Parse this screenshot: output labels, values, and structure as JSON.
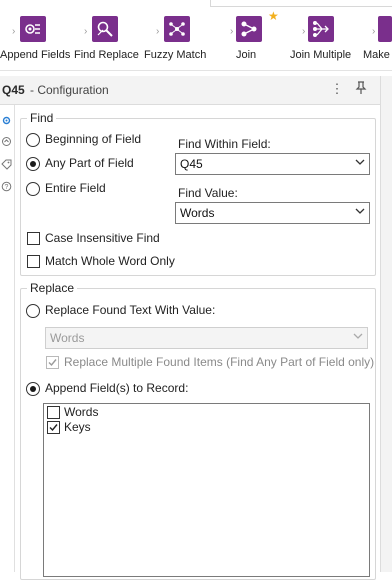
{
  "ribbon": {
    "tools": [
      {
        "label": "Append Fields",
        "icon": "append-fields-icon"
      },
      {
        "label": "Find Replace",
        "icon": "find-replace-icon"
      },
      {
        "label": "Fuzzy Match",
        "icon": "fuzzy-match-icon"
      },
      {
        "label": "Join",
        "icon": "join-icon"
      },
      {
        "label": "Join Multiple",
        "icon": "join-multiple-icon"
      },
      {
        "label": "Make G",
        "icon": "make-group-icon"
      }
    ],
    "favorite_icon": "star-icon"
  },
  "config": {
    "tool_id": "Q45",
    "title": "- Configuration",
    "menu_icon": "more-vertical-icon",
    "pin_icon": "pin-icon"
  },
  "find": {
    "legend": "Find",
    "options": [
      {
        "label": "Beginning of Field",
        "selected": false
      },
      {
        "label": "Any Part of Field",
        "selected": true
      },
      {
        "label": "Entire Field",
        "selected": false
      }
    ],
    "within_label": "Find Within Field:",
    "within_value": "Q45",
    "value_label": "Find Value:",
    "value_value": "Words",
    "case_insensitive": {
      "label": "Case Insensitive Find",
      "checked": false
    },
    "whole_word": {
      "label": "Match Whole Word Only",
      "checked": false
    }
  },
  "replace": {
    "legend": "Replace",
    "replace_text": {
      "label": "Replace Found Text With Value:",
      "selected": false
    },
    "replace_value": "Words",
    "replace_multiple": {
      "label": "Replace Multiple Found Items (Find Any Part of Field only)",
      "checked": true
    },
    "append_fields": {
      "label": "Append Field(s) to Record:",
      "selected": true
    },
    "fields": [
      {
        "label": "Words",
        "checked": false
      },
      {
        "label": "Keys",
        "checked": true
      }
    ]
  },
  "colors": {
    "tool_tile": "#7a2f8c",
    "favorite": "#f2b01e",
    "rail_accent": "#2a7fd4"
  }
}
